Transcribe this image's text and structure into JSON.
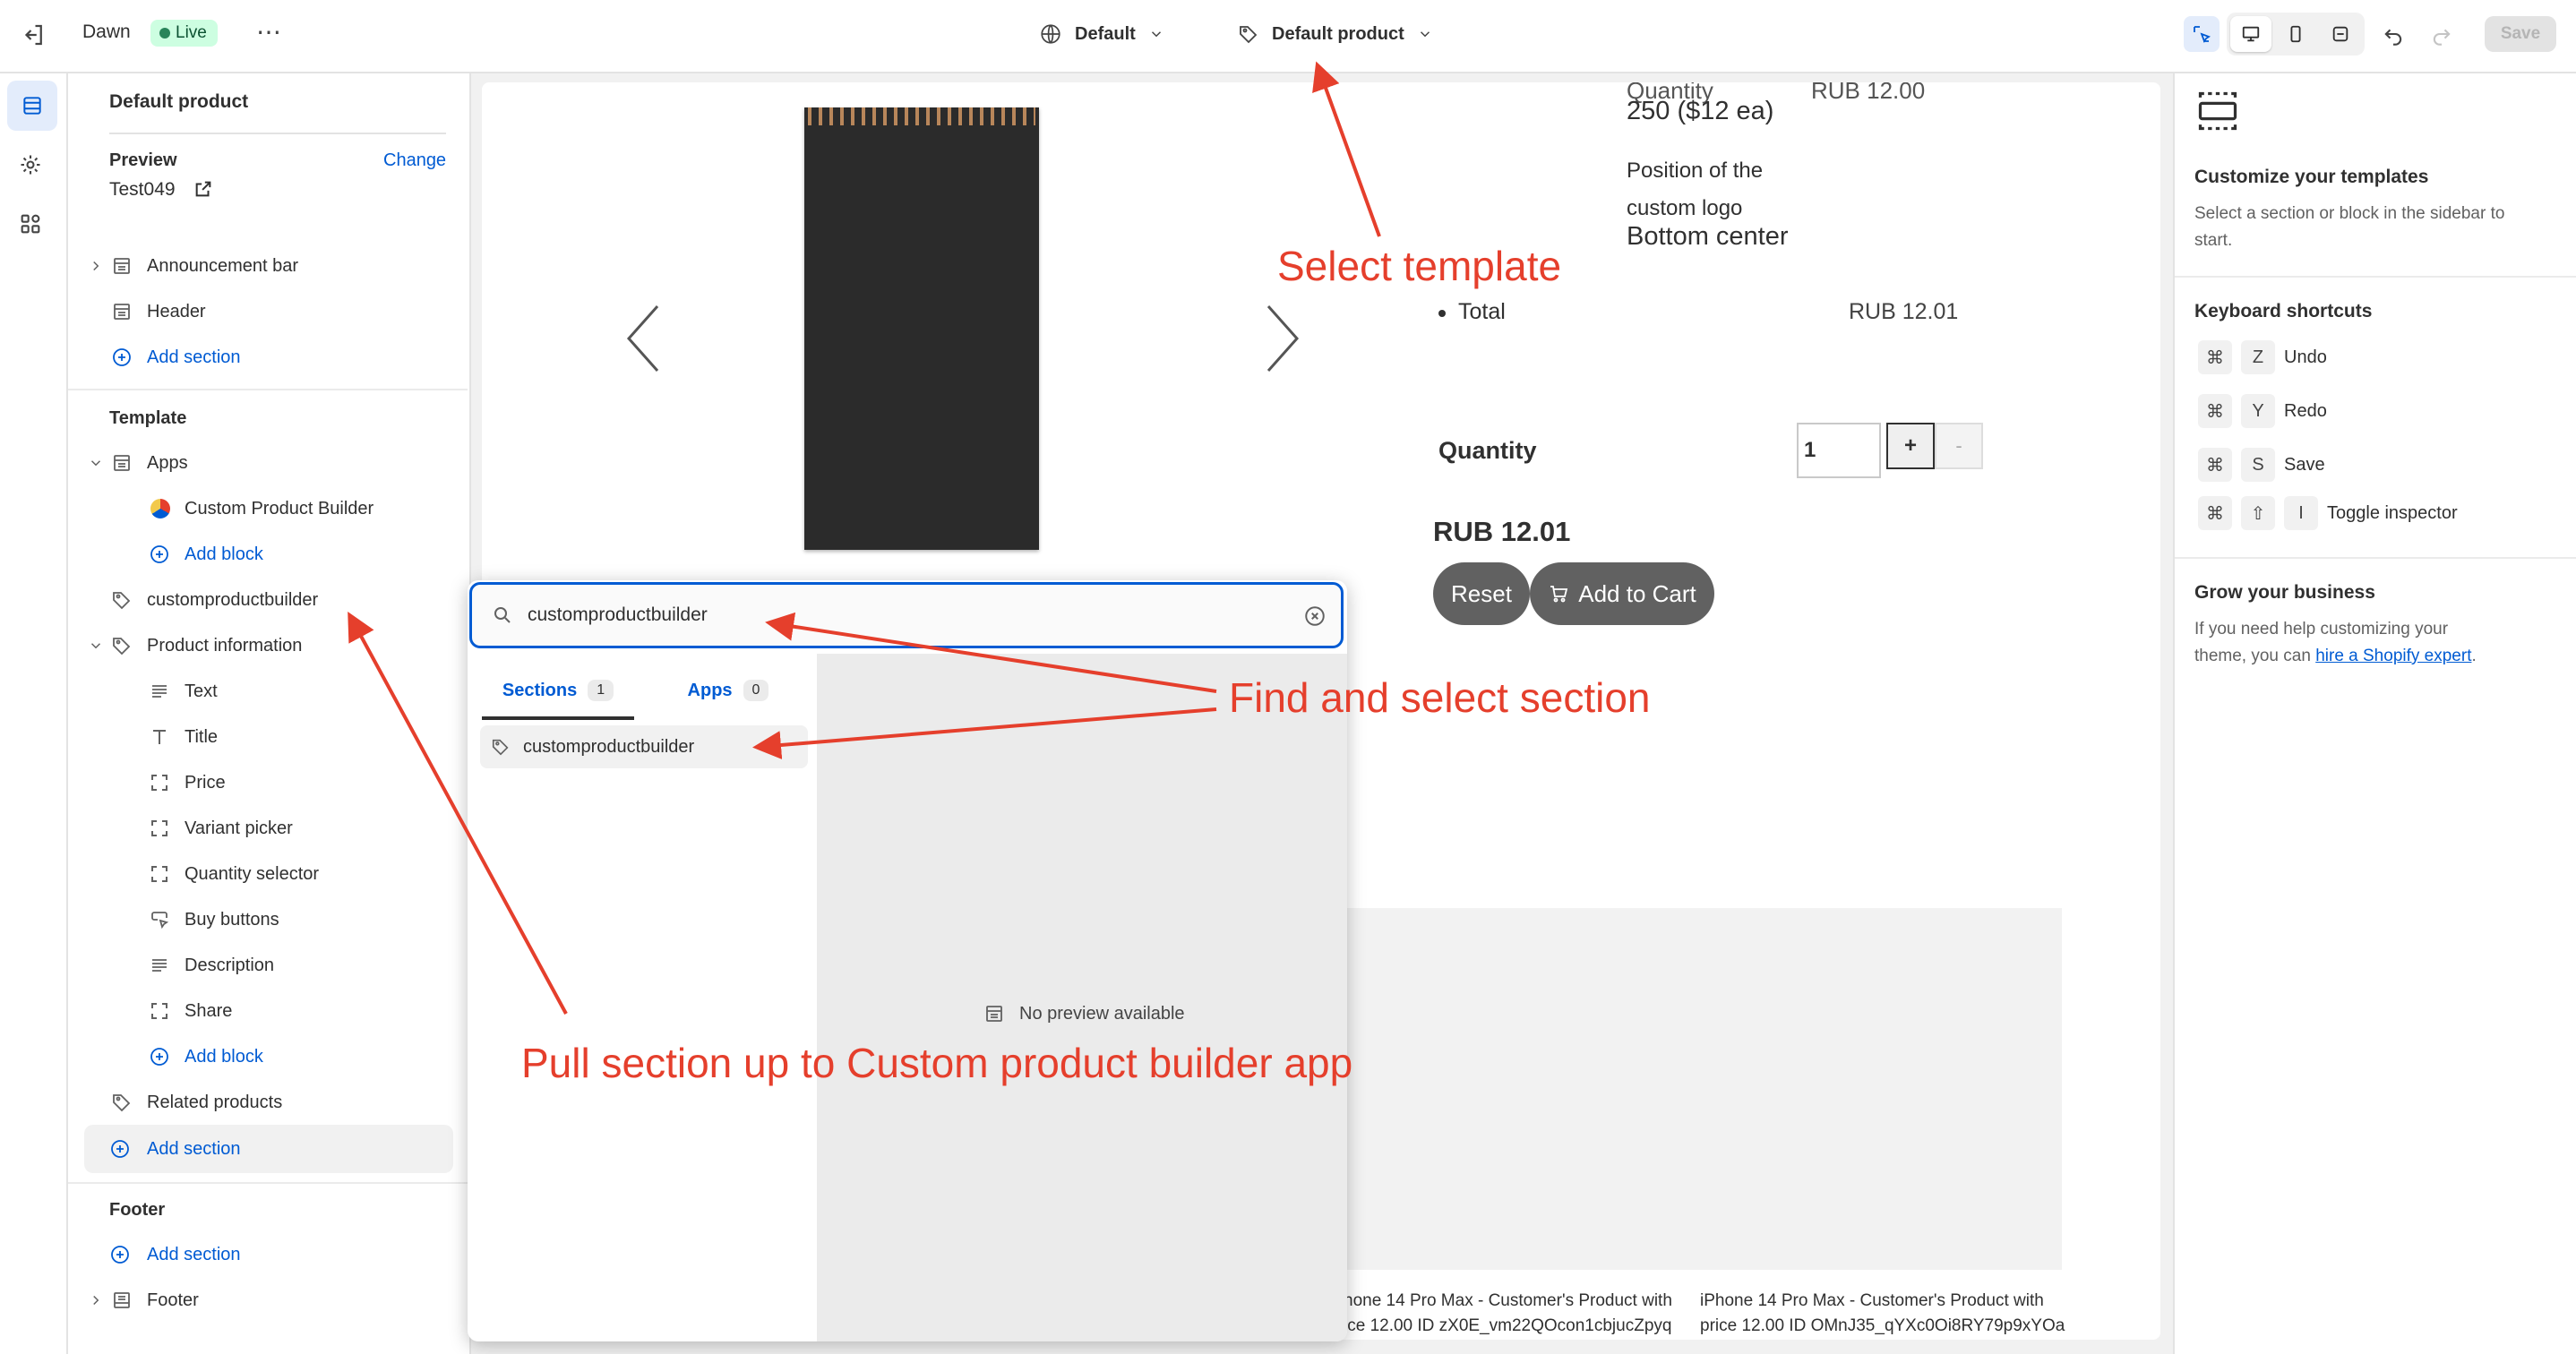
{
  "topbar": {
    "theme_name": "Dawn",
    "status_badge": "Live",
    "theme_selector": "Default",
    "template_selector": "Default product",
    "save_label": "Save"
  },
  "sidebar": {
    "title": "Default product",
    "preview_label": "Preview",
    "change_link": "Change",
    "preview_value": "Test049",
    "header_group": [
      "Announcement bar",
      "Header"
    ],
    "add_section": "Add section",
    "template_label": "Template",
    "apps_label": "Apps",
    "app_block": "Custom Product Builder",
    "add_block": "Add block",
    "custom_section": "customproductbuilder",
    "product_info": "Product information",
    "product_blocks": [
      "Text",
      "Title",
      "Price",
      "Variant picker",
      "Quantity selector",
      "Buy buttons",
      "Description",
      "Share"
    ],
    "related_products": "Related products",
    "footer_label": "Footer",
    "footer_item": "Footer"
  },
  "preview": {
    "quantity_cut": "Quantity",
    "price_cut": "RUB 12.00",
    "qty_desc": "250 ($12 ea)",
    "position_label": "Position of the custom logo",
    "position_value": "Bottom center",
    "total_label": "Total",
    "total_value": "RUB 12.01",
    "quantity_label": "Quantity",
    "quantity_value": "1",
    "plus": "+",
    "minus": "-",
    "price": "RUB 12.01",
    "reset": "Reset",
    "add_to_cart": "Add to Cart",
    "product_card_1": [
      "hone 14 Pro Max - Customer's Product with",
      "ice 12.00 ID zX0E_vm22QOcon1cbjucZpyq"
    ],
    "product_card_2": [
      "iPhone 14 Pro Max - Customer's Product with",
      "price 12.00 ID OMnJ35_qYXc0Oi8RY79p9xYOa"
    ]
  },
  "search_popover": {
    "query": "customproductbuilder",
    "tab_sections": "Sections",
    "tab_sections_count": "1",
    "tab_apps": "Apps",
    "tab_apps_count": "0",
    "result": "customproductbuilder",
    "no_preview": "No preview available"
  },
  "right_panel": {
    "title": "Customize your templates",
    "desc": "Select a section or block in the sidebar to start.",
    "shortcuts_title": "Keyboard shortcuts",
    "shortcuts": [
      {
        "keys": [
          "⌘",
          "Z"
        ],
        "label": "Undo"
      },
      {
        "keys": [
          "⌘",
          "Y"
        ],
        "label": "Redo"
      },
      {
        "keys": [
          "⌘",
          "S"
        ],
        "label": "Save"
      },
      {
        "keys": [
          "⌘",
          "⇧",
          "I"
        ],
        "label": "Toggle inspector"
      }
    ],
    "grow_title": "Grow your business",
    "grow_desc_1": "If you need help customizing your",
    "grow_desc_2": "theme, you can",
    "grow_link": "hire a Shopify expert",
    "grow_end": "."
  },
  "annotations": {
    "select_template": "Select template",
    "find_select": "Find and select section",
    "pull_section": "Pull section up to Custom product builder app"
  },
  "colors": {
    "accent": "#005bd3",
    "annotation": "#e53f2c",
    "live_badge": "#cdfee1"
  }
}
